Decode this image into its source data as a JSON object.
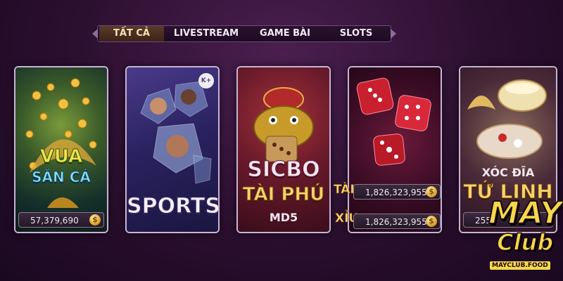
{
  "tabs": [
    {
      "label": "TẤT CẢ",
      "active": true
    },
    {
      "label": "LIVESTREAM",
      "active": false
    },
    {
      "label": "GAME BÀI",
      "active": false
    },
    {
      "label": "SLOTS",
      "active": false
    }
  ],
  "cards": {
    "vua_san_ca": {
      "title_line1": "VUA",
      "title_line2": "SĂN CÁ",
      "jackpot": "57,379,690"
    },
    "sports": {
      "title": "SPORTS",
      "badge": "K+"
    },
    "sicbo": {
      "title_line1": "SICBO",
      "title_line2": "TÀI PHÚ",
      "title_line3": "MD5",
      "tai_label": "TÀI",
      "tai_value": "1,826,323,955",
      "xiu_label": "XỈU",
      "xiu_value": "1,826,323,955"
    },
    "dice": {},
    "xoc_dia": {
      "title_line1": "XÓC ĐĨA",
      "title_line2": "TỨ LINH",
      "jackpot": "255"
    }
  },
  "logo": {
    "line1": "MAY",
    "line2": "Club",
    "domain": "MAYCLUB.FOOD"
  },
  "coin_symbol": "$",
  "colors": {
    "accent_gold": "#f6d36a",
    "border": "#c9b3d6",
    "tab_active": "#f6e3b0"
  }
}
